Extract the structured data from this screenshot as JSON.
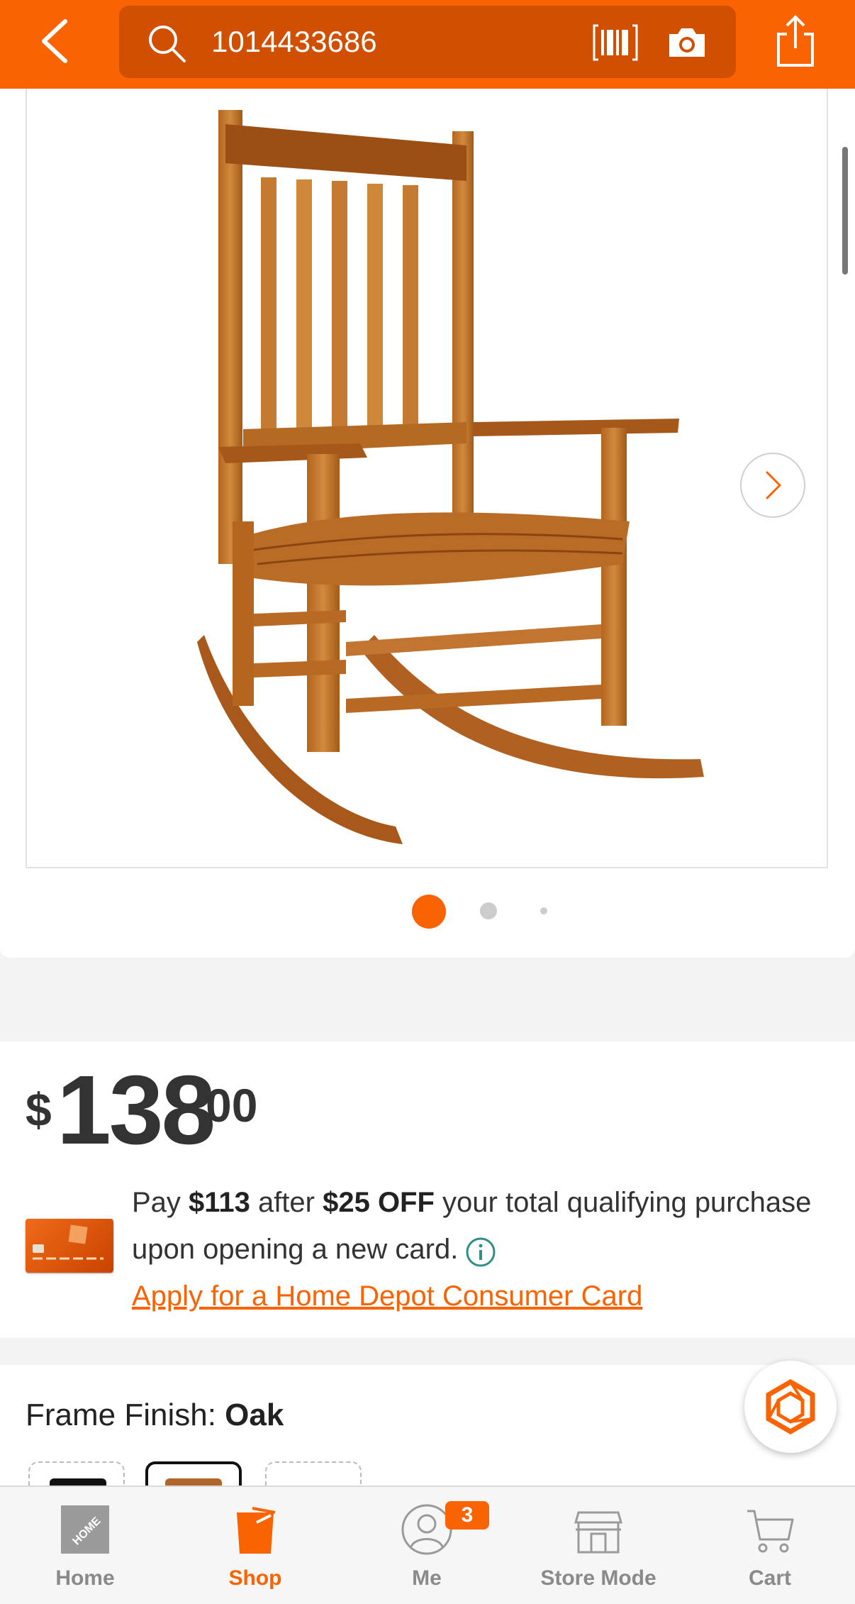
{
  "header": {
    "search_value": "1014433686",
    "icons": [
      "back-arrow-icon",
      "search-icon",
      "barcode-icon",
      "camera-icon",
      "share-icon"
    ],
    "color": "#f96302"
  },
  "gallery": {
    "image_alt": "wooden rocking chair",
    "total_images": 3,
    "active_index": 0
  },
  "price": {
    "currency": "$",
    "dollars": "138",
    "cents": "00"
  },
  "promo": {
    "text_1": "Pay ",
    "amount_after": "$113",
    "text_2": " after ",
    "discount": "$25 OFF",
    "text_3": " your total qualifying purchase upon opening a new card.",
    "apply_link": "Apply for a Home Depot Consumer Card"
  },
  "finish": {
    "label": "Frame Finish: ",
    "value": "Oak"
  },
  "bottom_nav": {
    "items": [
      {
        "label": "Home",
        "icon": "home-depot-logo-icon"
      },
      {
        "label": "Shop",
        "icon": "shop-bucket-icon"
      },
      {
        "label": "Me",
        "icon": "user-icon"
      },
      {
        "label": "Store Mode",
        "icon": "store-icon"
      },
      {
        "label": "Cart",
        "icon": "cart-icon"
      }
    ],
    "active": "Shop",
    "me_badge": "3"
  },
  "colors": {
    "brand_orange": "#f96302",
    "search_bg": "#d14f00",
    "link_teal": "#2f8f87"
  }
}
